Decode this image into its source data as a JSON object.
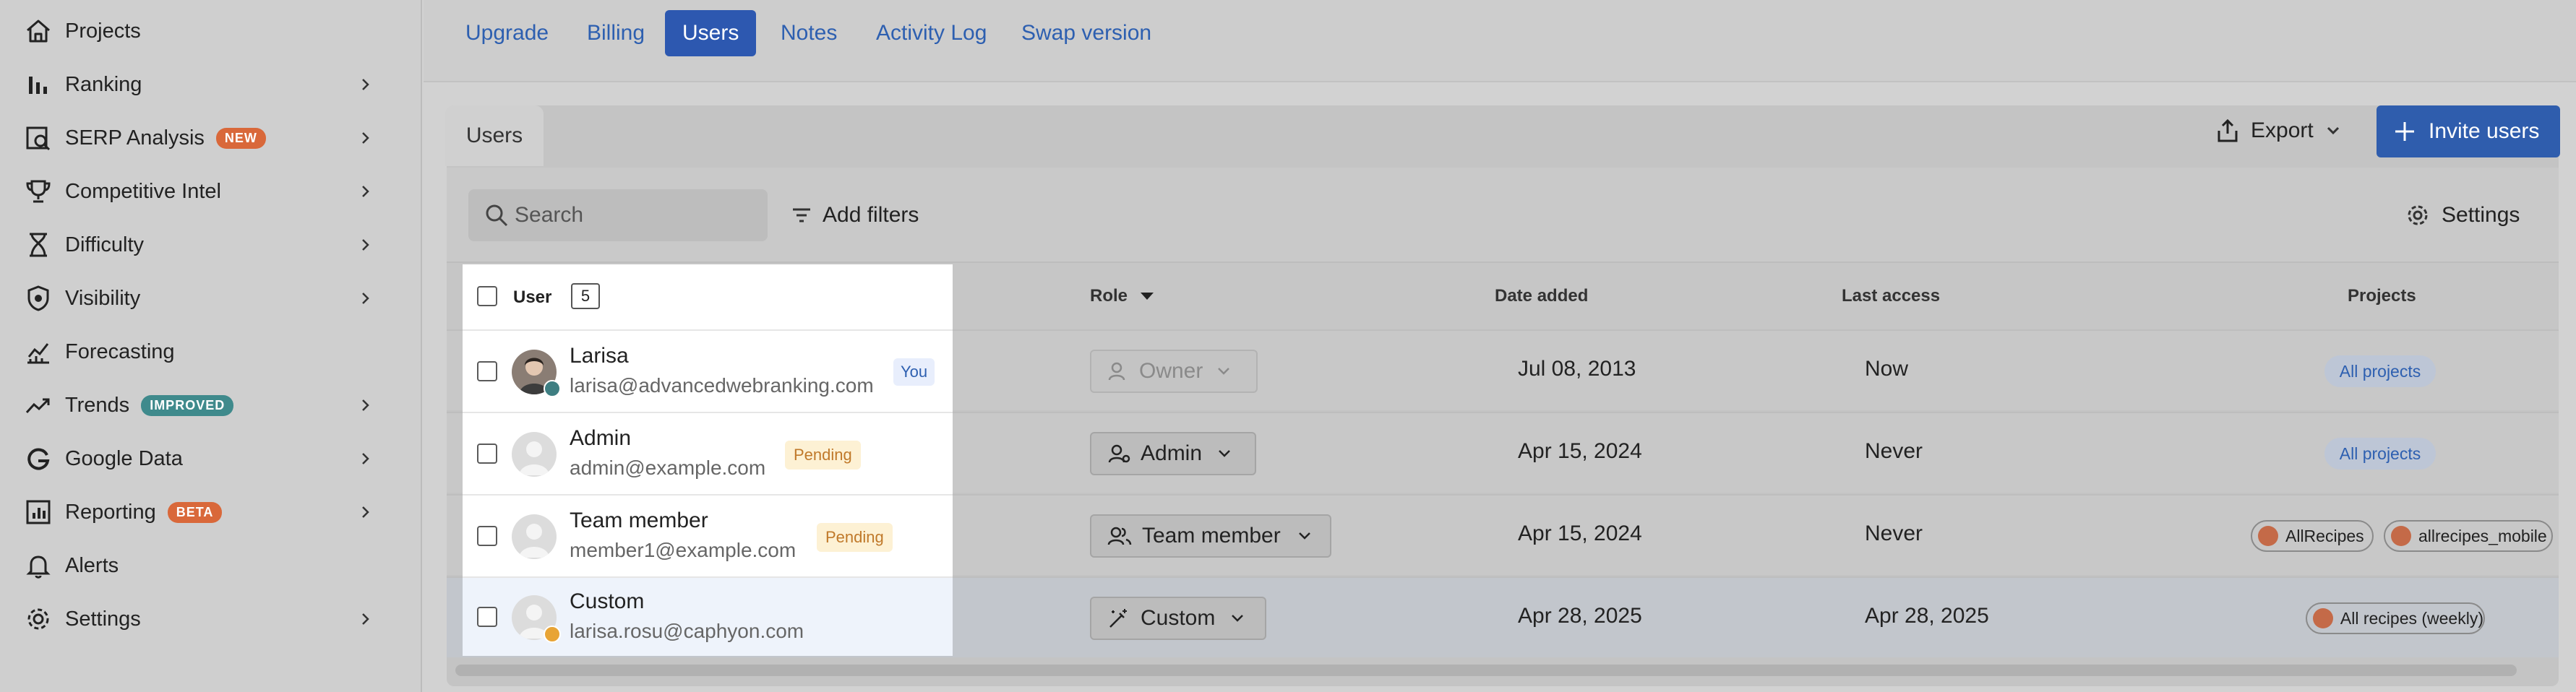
{
  "colors": {
    "accent": "#2d58b0",
    "badge_new": "#d9683a",
    "badge_improved": "#3f8a8c",
    "badge_beta": "#d9683a",
    "pending_bg": "#fdf1d4",
    "pending_text": "#c0792a"
  },
  "sidebar": {
    "items": [
      {
        "label": "Projects",
        "icon": "home-icon"
      },
      {
        "label": "Ranking",
        "icon": "bar-chart-icon"
      },
      {
        "label": "SERP Analysis",
        "icon": "serp-search-icon",
        "badge": "NEW"
      },
      {
        "label": "Competitive Intel",
        "icon": "trophy-icon"
      },
      {
        "label": "Difficulty",
        "icon": "hourglass-icon"
      },
      {
        "label": "Visibility",
        "icon": "eye-shield-icon"
      },
      {
        "label": "Forecasting",
        "icon": "forecast-chart-icon"
      },
      {
        "label": "Trends",
        "icon": "trend-arrow-icon",
        "badge": "IMPROVED"
      },
      {
        "label": "Google Data",
        "icon": "google-icon"
      },
      {
        "label": "Reporting",
        "icon": "report-icon",
        "badge": "BETA"
      },
      {
        "label": "Alerts",
        "icon": "bell-icon"
      },
      {
        "label": "Settings",
        "icon": "gear-icon"
      }
    ]
  },
  "tabs": [
    "Upgrade",
    "Billing",
    "Users",
    "Notes",
    "Activity Log",
    "Swap version"
  ],
  "active_tab": "Users",
  "card_tab": "Users",
  "actions": {
    "export": "Export",
    "invite": "Invite users"
  },
  "toolbar": {
    "search_placeholder": "Search",
    "filters": "Add filters",
    "settings": "Settings"
  },
  "table": {
    "columns": {
      "user": "User",
      "user_count": "5",
      "role": "Role",
      "date_added": "Date added",
      "last_access": "Last access",
      "projects": "Projects"
    },
    "rows": [
      {
        "name": "Larisa",
        "email": "larisa@advancedwebranking.com",
        "tag": "You",
        "role": "Owner",
        "date_added": "Jul 08, 2013",
        "last_access": "Now",
        "projects": [
          "All projects"
        ]
      },
      {
        "name": "Admin",
        "email": "admin@example.com",
        "tag": "Pending",
        "role": "Admin",
        "date_added": "Apr 15, 2024",
        "last_access": "Never",
        "projects": [
          "All projects"
        ]
      },
      {
        "name": "Team member",
        "email": "member1@example.com",
        "tag": "Pending",
        "role": "Team member",
        "date_added": "Apr 15, 2024",
        "last_access": "Never",
        "projects": [
          "AllRecipes",
          "allrecipes_mobile"
        ]
      },
      {
        "name": "Custom",
        "email": "larisa.rosu@caphyon.com",
        "tag": "",
        "role": "Custom",
        "date_added": "Apr 28, 2025",
        "last_access": "Apr 28, 2025",
        "projects": [
          "All recipes (weekly)"
        ]
      }
    ]
  }
}
